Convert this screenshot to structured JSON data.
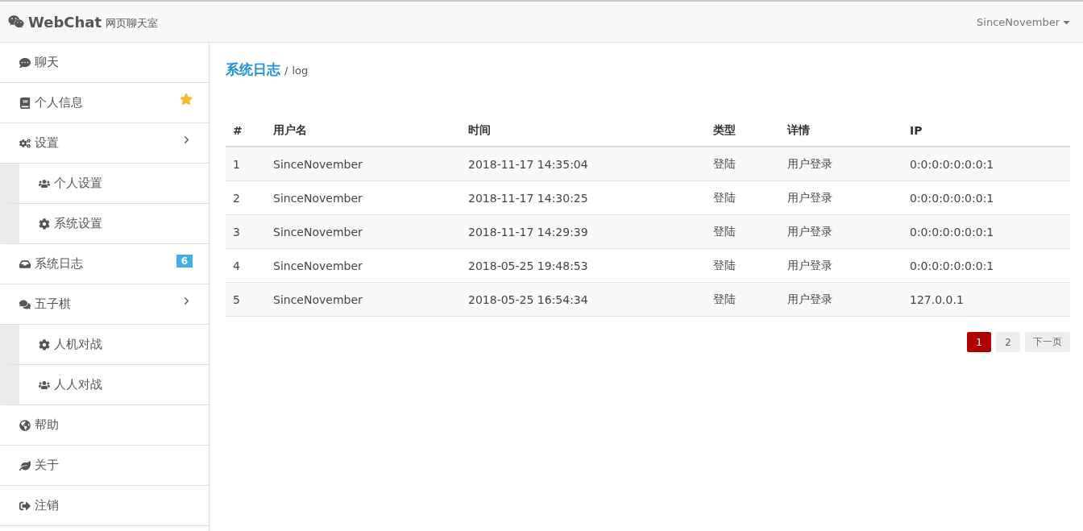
{
  "navbar": {
    "brand": "WebChat",
    "subtitle": "网页聊天室",
    "user": "SinceNovember"
  },
  "sidebar": {
    "items": [
      {
        "label": "聊天"
      },
      {
        "label": "个人信息",
        "starred": true
      },
      {
        "label": "设置",
        "expanded": true,
        "children": [
          {
            "label": "个人设置"
          },
          {
            "label": "系统设置"
          }
        ]
      },
      {
        "label": "系统日志",
        "badge": "6"
      },
      {
        "label": "五子棋",
        "expanded": true,
        "children": [
          {
            "label": "人机对战"
          },
          {
            "label": "人人对战"
          }
        ]
      },
      {
        "label": "帮助"
      },
      {
        "label": "关于"
      },
      {
        "label": "注销"
      }
    ]
  },
  "page": {
    "title": "系统日志",
    "separator": "/",
    "subtitle": "log"
  },
  "table": {
    "columns": [
      "#",
      "用户名",
      "时间",
      "类型",
      "详情",
      "IP"
    ],
    "rows": [
      [
        "1",
        "SinceNovember",
        "2018-11-17 14:35:04",
        "登陆",
        "用户登录",
        "0:0:0:0:0:0:0:1"
      ],
      [
        "2",
        "SinceNovember",
        "2018-11-17 14:30:25",
        "登陆",
        "用户登录",
        "0:0:0:0:0:0:0:1"
      ],
      [
        "3",
        "SinceNovember",
        "2018-11-17 14:29:39",
        "登陆",
        "用户登录",
        "0:0:0:0:0:0:0:1"
      ],
      [
        "4",
        "SinceNovember",
        "2018-05-25 19:48:53",
        "登陆",
        "用户登录",
        "0:0:0:0:0:0:0:1"
      ],
      [
        "5",
        "SinceNovember",
        "2018-05-25 16:54:34",
        "登陆",
        "用户登录",
        "127.0.0.1"
      ]
    ]
  },
  "pagination": {
    "pages": [
      {
        "label": "1",
        "selected": true
      },
      {
        "label": "2",
        "selected": false
      }
    ],
    "next": "下一页"
  }
}
